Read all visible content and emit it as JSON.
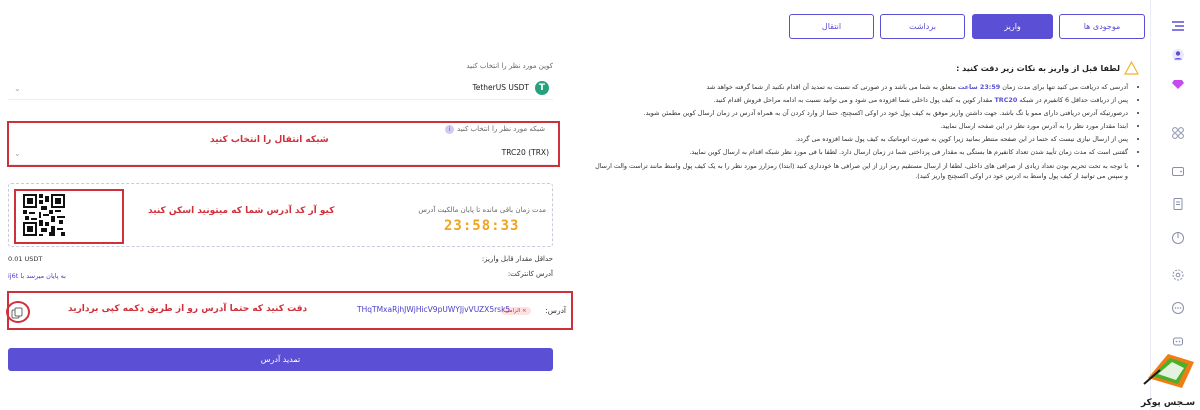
{
  "tabs": [
    {
      "label": "موجودی ها",
      "active": false
    },
    {
      "label": "واریز",
      "active": true
    },
    {
      "label": "برداشت",
      "active": false
    },
    {
      "label": "انتقال",
      "active": false
    }
  ],
  "notice": {
    "title": "لطفا قبل از واریز به نکات زیر دقت کنید :",
    "items": [
      {
        "pre": "آدرسی که دریافت می کنید تنها برای مدت زمان ",
        "hl": "23:59 ساعت",
        "post": " متعلق به شما می باشد و در صورتی که نسبت به تمدید آن اقدام نکنید از شما گرفته خواهد شد"
      },
      {
        "pre": "پس از دریافت حداقل 6 کانفیرم در شبکه ",
        "hl": "TRC20",
        "post": " مقدار کوین به کیف پول داخلی شما افزوده می شود و می توانید نسبت به ادامه مراحل فروش اقدام کنید."
      },
      {
        "pre": "درصورتیکه آدرس دریافتی دارای ممو یا تگ باشد. جهت داشتن واریز موفق به کیف پول خود در اوکی اکسچنج، حتما از وارد کردن آن به همراه آدرس در زمان ارسال کوین مطمئن شوید.",
        "hl": "",
        "post": ""
      },
      {
        "pre": "ابتدا مقدار مورد نظر را به آدرس مورد نظر در این صفحه ارسال نمایید.",
        "hl": "",
        "post": ""
      },
      {
        "pre": "پس از ارسال نیازی نیست که حتما در این صفحه منتظر بمانید زیرا کوین به صورت اتوماتیک به کیف پول شما افزوده می گردد.",
        "hl": "",
        "post": ""
      },
      {
        "pre": "گفتنی است که مدت زمان تأیید شدن تعداد کانفیرم ها بستگی به مقدار فی پرداختی شما در زمان ارسال دارد. لطفا با فی مورد نظر شبکه اقدام به ارسال کوین نمایید.",
        "hl": "",
        "post": ""
      },
      {
        "pre": "با توجه به تحت تحریم بودن تعداد زیادی از صرافی های داخلی، لطفا از ارسال مستقیم رمز ارز از این صرافی ها خودداری کنید (ابتدا) رمزارز مورد نظر را به یک کیف پول واسط مانند تراست والت ارسال و سپس می توانید از کیف پول واسط به ادرس خود در اوکی اکسچنج واریز کنید).",
        "hl": "",
        "post": ""
      }
    ]
  },
  "form": {
    "coin_label": "کوین مورد نظر را انتخاب کنید",
    "coin_value": "TetherUS  USDT",
    "coin_icon": "tether-icon",
    "network_label": "شبکه مورد نظر را انتخاب کنید",
    "network_value": "TRC20 (TRX)",
    "network_annotation": "شبکه انتقال را انتخاب کنید",
    "timer_label": "مدت زمان باقی مانده تا پایان مالکیت آدرس",
    "timer_value": "23:58:33",
    "qr_annotation": "کیو آر کد آدرس شما که میتونید اسکن کنید",
    "min_label": "حداقل مقدار قابل واریز:",
    "min_value": "0.01 USDT",
    "contract_label": "آدرس کانترکت:",
    "contract_value": "به پایان میرسد با ij6t",
    "address_label": "آدرس:",
    "address_badge": "الزامی ×",
    "address_value": "THqTMxaRjhJWjHicV9pUWYJjvVUZX5rsk5",
    "copy_annotation": "دقت کنید که حتما آدرس رو از طریق دکمه کپی بردارید",
    "renew_button": "تمدید آدرس"
  },
  "logo_text": "سـجس پوکر",
  "colors": {
    "accent": "#5b4fd6",
    "highlight_red": "#d0303a",
    "timer": "#f0a320",
    "tether": "#26a17b"
  }
}
